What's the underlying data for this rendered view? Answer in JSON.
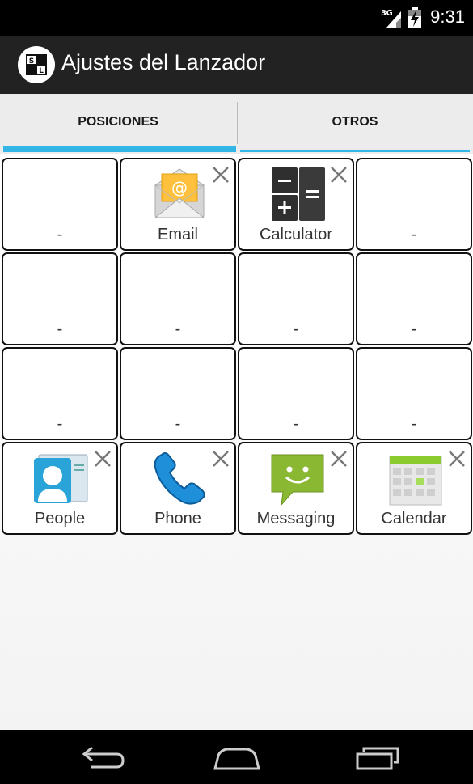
{
  "status_bar": {
    "network": "3G",
    "time": "9:31",
    "icons": [
      "signal-icon",
      "battery-icon"
    ]
  },
  "action_bar": {
    "app_icon": "launcher-settings-icon",
    "app_icon_letters": [
      "S",
      "L"
    ],
    "title": "Ajustes del Lanzador"
  },
  "tabs": [
    {
      "label": "POSICIONES",
      "selected": true
    },
    {
      "label": "OTROS",
      "selected": false
    }
  ],
  "accent_color": "#33b5e5",
  "grid": {
    "rows": 4,
    "columns": 4,
    "cells": [
      {
        "label": "-",
        "icon": "",
        "removable": false
      },
      {
        "label": "Email",
        "icon": "email-icon",
        "removable": true
      },
      {
        "label": "Calculator",
        "icon": "calculator-icon",
        "removable": true
      },
      {
        "label": "-",
        "icon": "",
        "removable": false
      },
      {
        "label": "-",
        "icon": "",
        "removable": false
      },
      {
        "label": "-",
        "icon": "",
        "removable": false
      },
      {
        "label": "-",
        "icon": "",
        "removable": false
      },
      {
        "label": "-",
        "icon": "",
        "removable": false
      },
      {
        "label": "-",
        "icon": "",
        "removable": false
      },
      {
        "label": "-",
        "icon": "",
        "removable": false
      },
      {
        "label": "-",
        "icon": "",
        "removable": false
      },
      {
        "label": "-",
        "icon": "",
        "removable": false
      },
      {
        "label": "People",
        "icon": "people-icon",
        "removable": true
      },
      {
        "label": "Phone",
        "icon": "phone-icon",
        "removable": true
      },
      {
        "label": "Messaging",
        "icon": "messaging-icon",
        "removable": true
      },
      {
        "label": "Calendar",
        "icon": "calendar-icon",
        "removable": true
      }
    ]
  },
  "nav_bar": {
    "buttons": [
      "back-icon",
      "home-icon",
      "recent-apps-icon"
    ]
  }
}
